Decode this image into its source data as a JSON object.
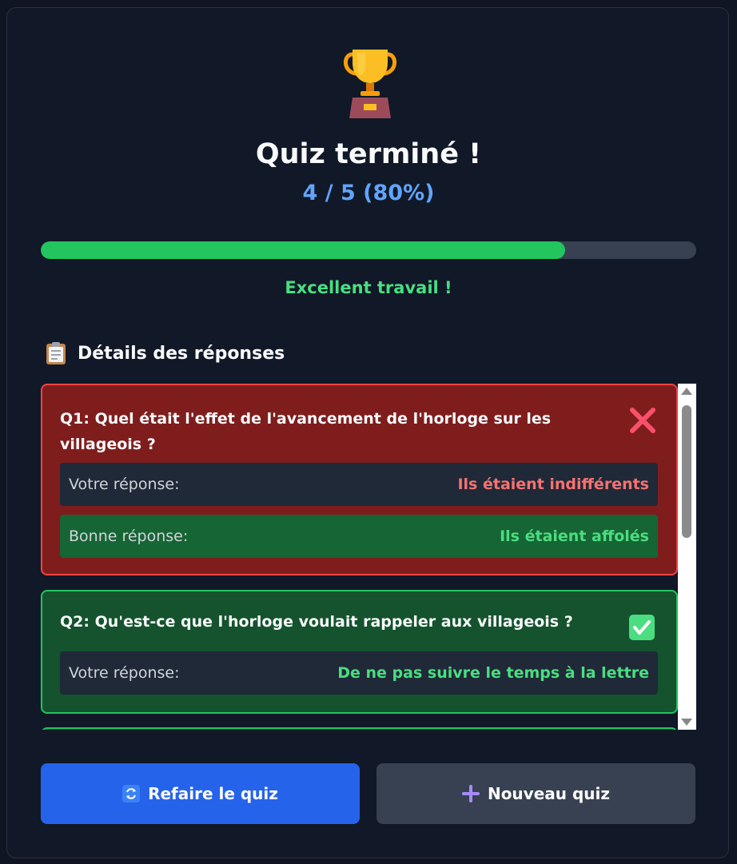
{
  "result": {
    "title": "Quiz terminé !",
    "score": "4 / 5 (80%)",
    "progress_fraction": 0.8,
    "feedback": "Excellent travail !",
    "icon": "trophy-icon"
  },
  "details": {
    "title": "Détails des réponses",
    "icon": "clipboard-icon",
    "answers": [
      {
        "question": "Q1: Quel était l'effet de l'avancement de l'horloge sur les villageois ?",
        "status": "incorrect",
        "status_icon": "cross-icon",
        "your_answer_label": "Votre réponse:",
        "your_answer": "Ils étaient indifférents",
        "correct_answer_label": "Bonne réponse:",
        "correct_answer": "Ils étaient affolés"
      },
      {
        "question": "Q2: Qu'est-ce que l'horloge voulait rappeler aux villageois ?",
        "status": "correct",
        "status_icon": "check-icon",
        "your_answer_label": "Votre réponse:",
        "your_answer": "De ne pas suivre le temps à la lettre"
      }
    ]
  },
  "actions": {
    "retry_label": "Refaire le quiz",
    "retry_icon": "refresh-icon",
    "new_label": "Nouveau quiz",
    "new_icon": "plus-icon"
  },
  "colors": {
    "background": "#111827",
    "accent_blue": "#60a5fa",
    "success": "#22c55e",
    "error": "#ef4444",
    "primary_button": "#2563eb"
  }
}
